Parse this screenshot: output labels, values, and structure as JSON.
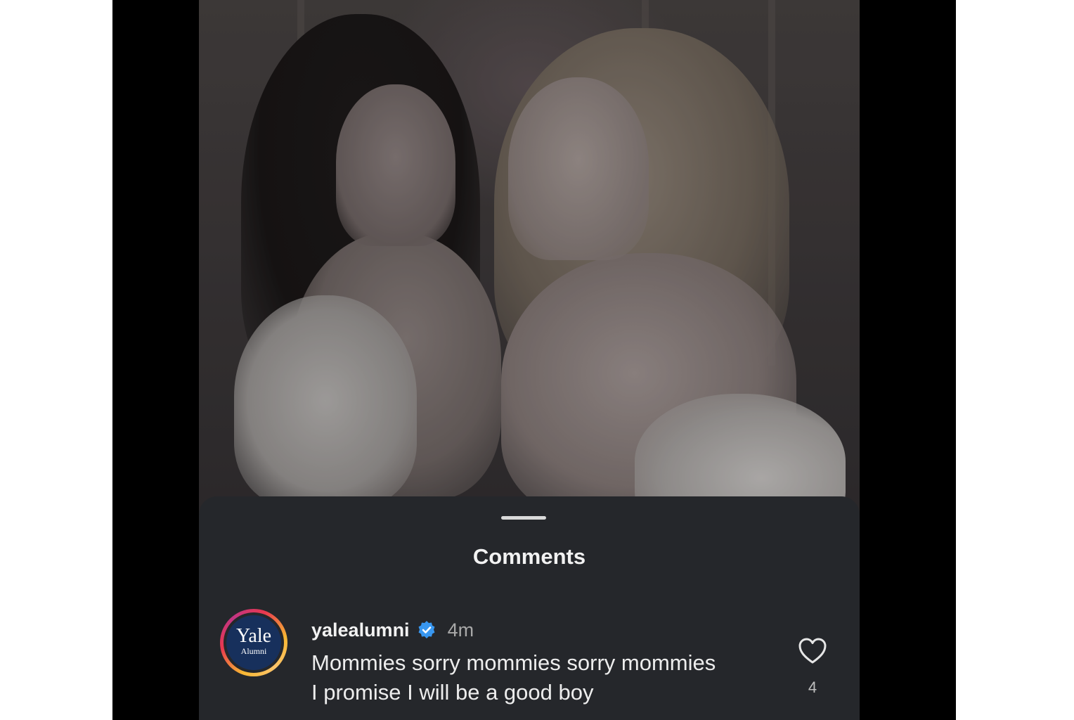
{
  "sheet": {
    "title": "Comments"
  },
  "comment": {
    "username": "yalealumni",
    "verified": true,
    "time": "4m",
    "text_line1": "Mommies sorry mommies sorry mommies",
    "text_line2": "I promise I will be a good boy",
    "like_count": "4",
    "avatar": {
      "line1": "Yale",
      "line2": "Alumni"
    }
  },
  "colors": {
    "sheet_bg": "#25272b",
    "verified_blue": "#3897f0",
    "avatar_bg": "#17305c"
  },
  "icons": {
    "verified": "verified-badge-icon",
    "like": "heart-outline-icon"
  }
}
